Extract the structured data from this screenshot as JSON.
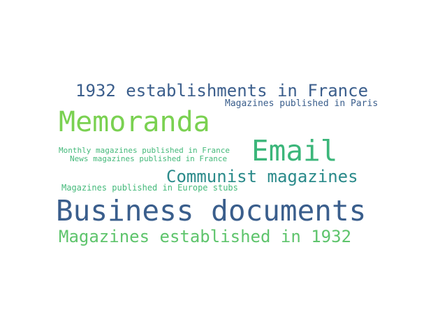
{
  "words": [
    {
      "id": "business",
      "text": "Business documents",
      "color": "#3a5e8c"
    },
    {
      "id": "memoranda",
      "text": "Memoranda",
      "color": "#7ad151"
    },
    {
      "id": "email",
      "text": "Email",
      "color": "#3bb67a"
    },
    {
      "id": "estab1932",
      "text": "1932 establishments in France",
      "color": "#3b5e8c"
    },
    {
      "id": "communist",
      "text": "Communist magazines",
      "color": "#2a8a8a"
    },
    {
      "id": "magest1932",
      "text": "Magazines established in 1932",
      "color": "#5ec46c"
    },
    {
      "id": "paris",
      "text": "Magazines published in Paris",
      "color": "#3a5e8c"
    },
    {
      "id": "monthly",
      "text": "Monthly magazines published in France",
      "color": "#44b97a"
    },
    {
      "id": "news",
      "text": "News magazines published in France",
      "color": "#44b97a"
    },
    {
      "id": "europe",
      "text": "Magazines published in Europe stubs",
      "color": "#44b97a"
    }
  ]
}
